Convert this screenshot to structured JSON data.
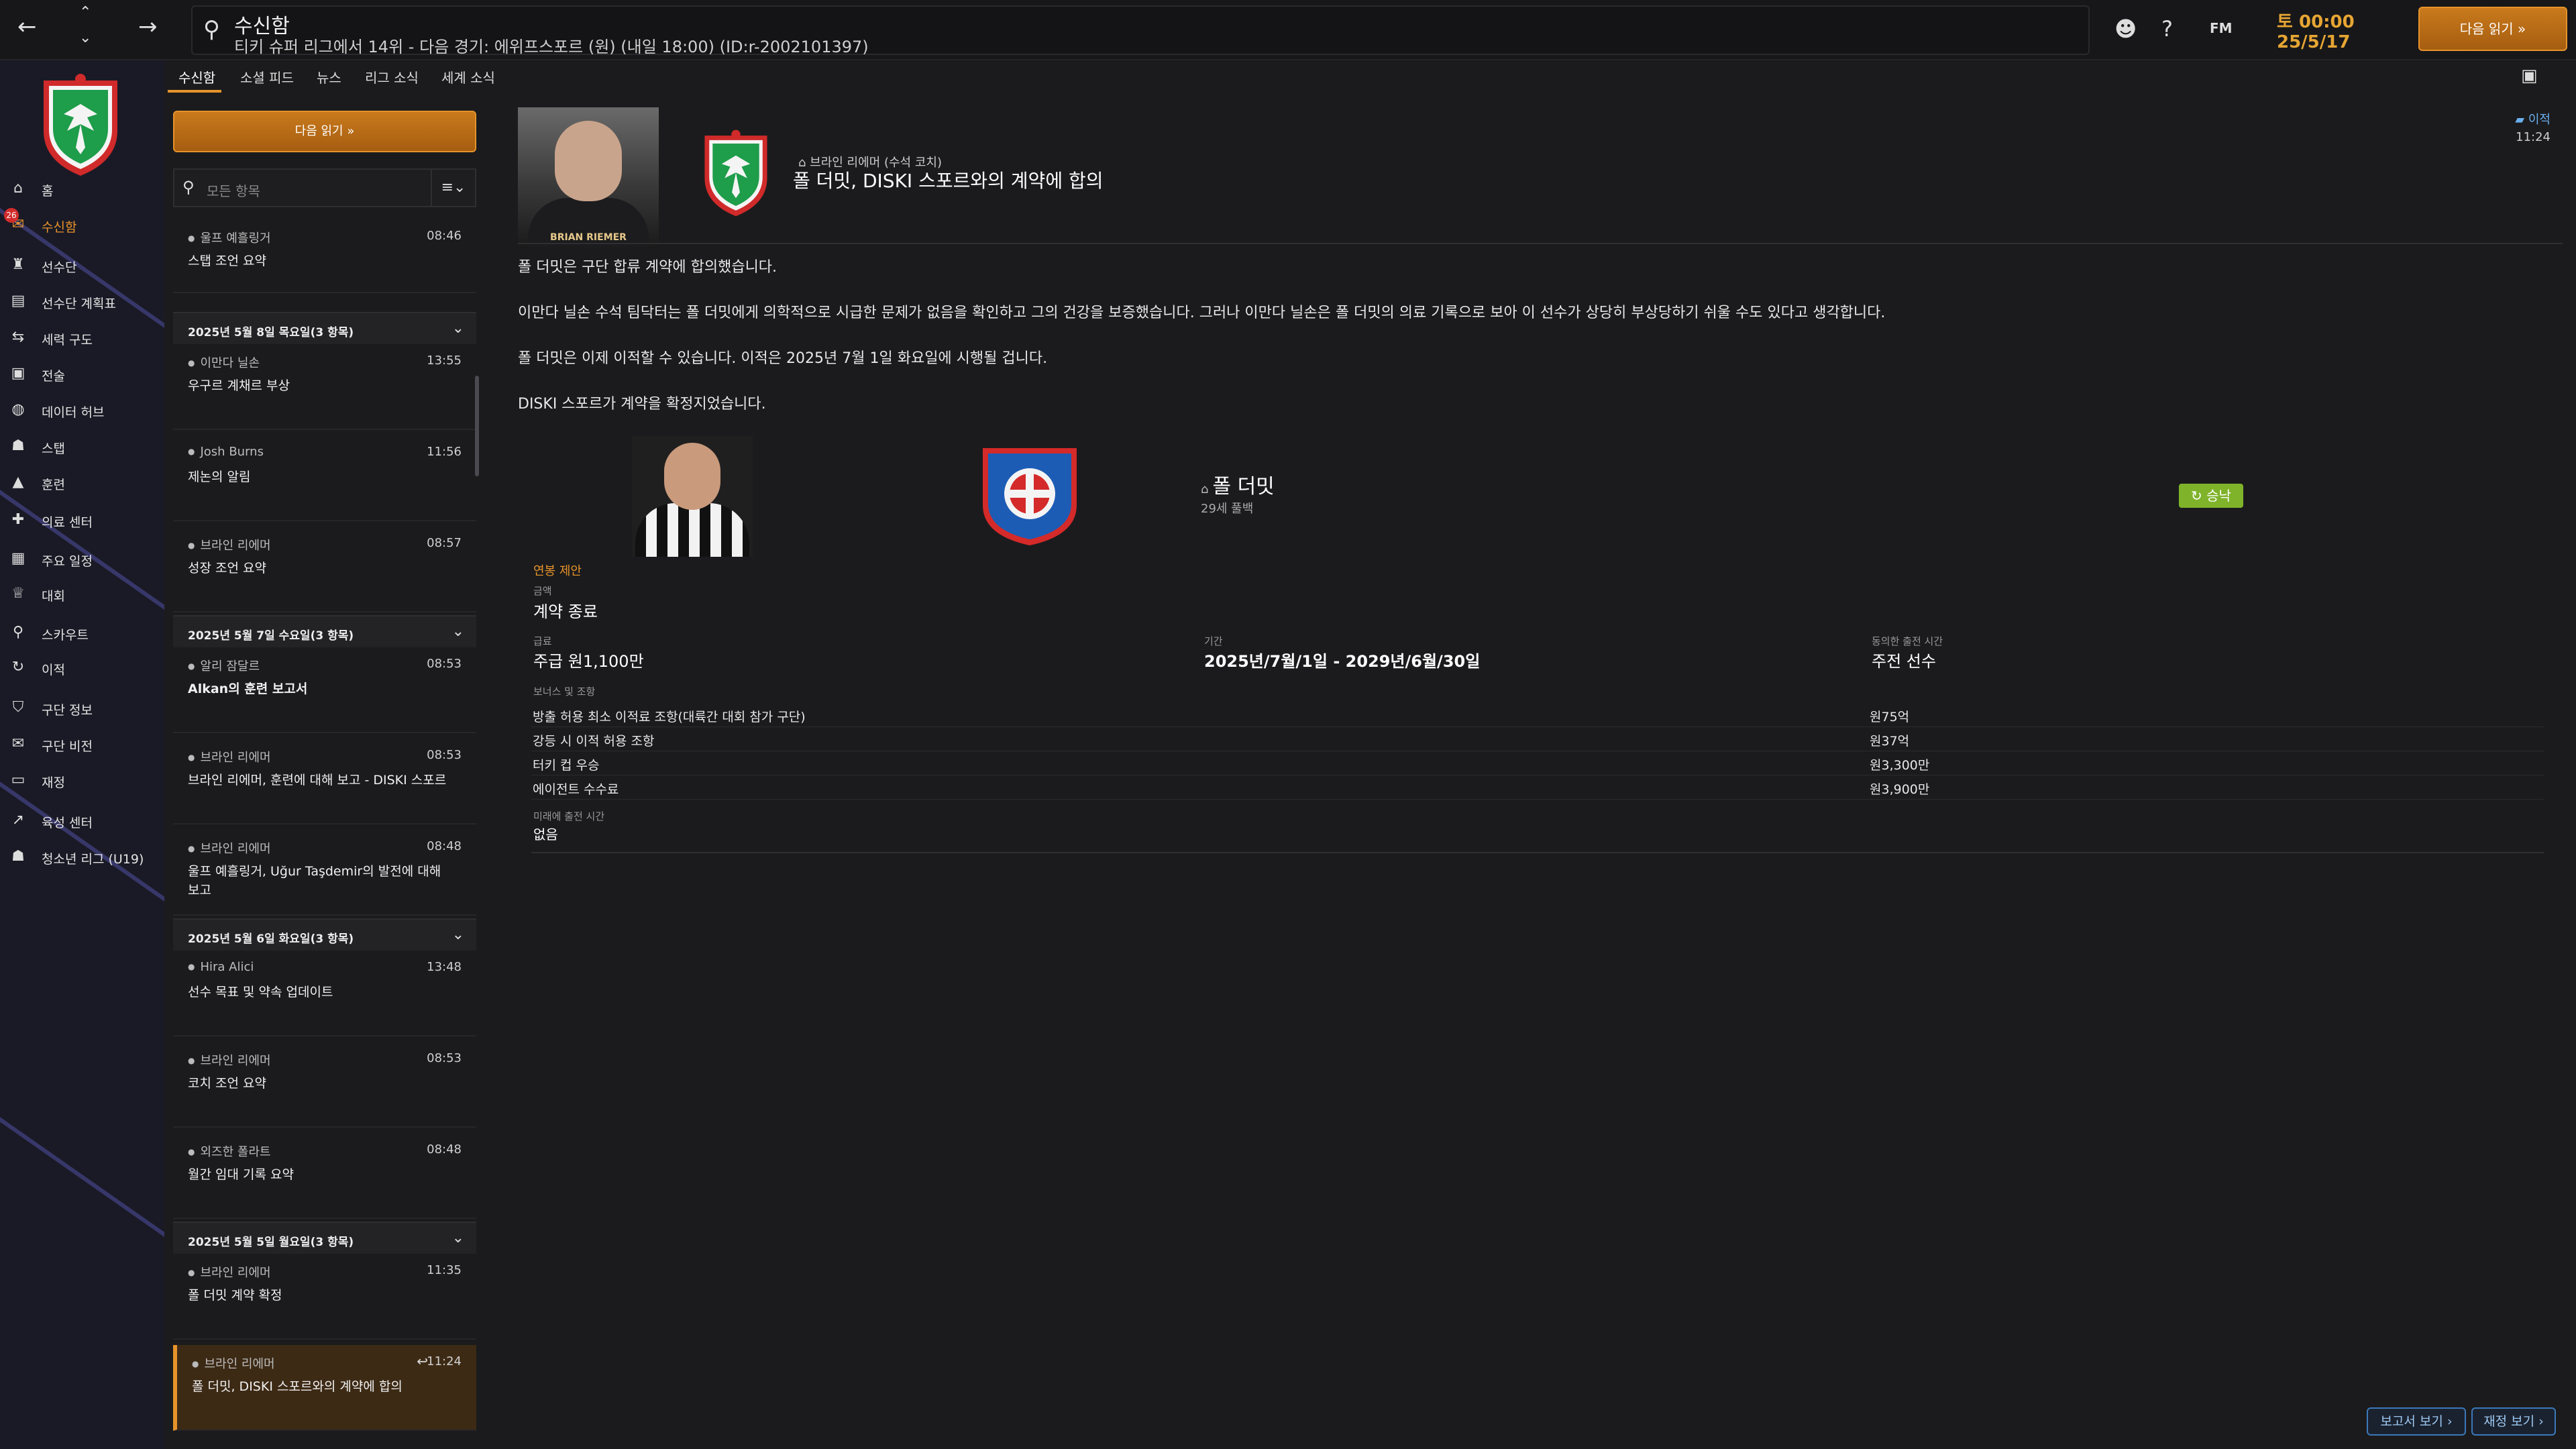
{
  "topbar": {
    "title": "수신함",
    "subtitle": "티키 슈퍼 리그에서 14위 - 다음 경기: 에위프스포르 (원) (내일 18:00) (ID:r-2002101397)",
    "game_time": "토 00:00",
    "game_date": "25/5/17",
    "continue_label": "다음 읽기",
    "fm_label": "FM"
  },
  "sidebar": {
    "inbox_badge": "26",
    "items": [
      {
        "label": "홈",
        "icon": "home-icon"
      },
      {
        "label": "수신함",
        "icon": "inbox-icon"
      },
      {
        "label": "선수단",
        "icon": "shirt-icon"
      },
      {
        "label": "선수단 계획표",
        "icon": "clipboard-icon"
      },
      {
        "label": "세력 구도",
        "icon": "dynamics-icon"
      },
      {
        "label": "전술",
        "icon": "tactics-icon"
      },
      {
        "label": "데이터 허브",
        "icon": "data-icon"
      },
      {
        "label": "스탭",
        "icon": "staff-icon"
      },
      {
        "label": "훈련",
        "icon": "training-icon"
      },
      {
        "label": "의료 센터",
        "icon": "medical-icon"
      },
      {
        "label": "주요 일정",
        "icon": "calendar-icon"
      },
      {
        "label": "대회",
        "icon": "trophy-icon"
      },
      {
        "label": "스카우트",
        "icon": "scout-icon"
      },
      {
        "label": "이적",
        "icon": "transfer-icon"
      },
      {
        "label": "구단 정보",
        "icon": "club-icon"
      },
      {
        "label": "구단 비전",
        "icon": "vision-icon"
      },
      {
        "label": "재정",
        "icon": "finance-icon"
      },
      {
        "label": "육성 센터",
        "icon": "development-icon"
      },
      {
        "label": "청소년 리그 (U19)",
        "icon": "youth-icon"
      }
    ]
  },
  "tabs": [
    "수신함",
    "소셜 피드",
    "뉴스",
    "리그 소식",
    "세계 소식"
  ],
  "list": {
    "continue_label": "다음 읽기",
    "search_placeholder": "모든 항목",
    "groups": [
      {
        "label": "2025년 5월 8일 목요일(3 항목)"
      },
      {
        "label": "2025년 5월 7일 수요일(3 항목)"
      },
      {
        "label": "2025년 5월 6일 화요일(3 항목)"
      },
      {
        "label": "2025년 5월 5일 월요일(3 항목)"
      }
    ],
    "messages": [
      {
        "sender": "울프 예흘링거",
        "time": "08:46",
        "subject": "스탭 조언 요약"
      },
      {
        "sender": "이만다 닐손",
        "time": "13:55",
        "subject": "우구르 계채르 부상"
      },
      {
        "sender": "Josh Burns",
        "time": "11:56",
        "subject": "제논의 알림"
      },
      {
        "sender": "브라인 리에머",
        "time": "08:57",
        "subject": "성장 조언 요약"
      },
      {
        "sender": "알리 잠달르",
        "time": "08:53",
        "subject": "Alkan의 훈련 보고서"
      },
      {
        "sender": "브라인 리에머",
        "time": "08:53",
        "subject": "브라인 리에머, 훈련에 대해 보고 - DISKI 스포르"
      },
      {
        "sender": "브라인 리에머",
        "time": "08:48",
        "subject": "울프 예흘링거, Uğur Taşdemir의 발전에 대해 보고"
      },
      {
        "sender": "Hira Alici",
        "time": "13:48",
        "subject": "선수 목표 및 약속 업데이트"
      },
      {
        "sender": "브라인 리에머",
        "time": "08:53",
        "subject": "코치 조언 요약"
      },
      {
        "sender": "외즈한 폴라트",
        "time": "08:48",
        "subject": "월간 임대 기록 요약"
      },
      {
        "sender": "브라인 리에머",
        "time": "11:35",
        "subject": "폴 더밋 계약 확정"
      },
      {
        "sender": "브라인 리에머",
        "time": "11:24",
        "subject": "폴 더밋, DISKI 스포르와의 계약에 합의"
      }
    ]
  },
  "message": {
    "from": "브라인 리에머 (수석 코치)",
    "title": "폴 더밋, DISKI 스포르와의 계약에 합의",
    "read_label": "이적",
    "time": "11:24",
    "coach_caption": "BRIAN RIEMER",
    "paragraphs": [
      "폴 더밋은 구단 합류 계약에 합의했습니다.",
      "이만다 닐손 수석 팀닥터는 폴 더밋에게 의학적으로 시급한 문제가 없음을 확인하고 그의 건강을 보증했습니다. 그러나 이만다 닐손은 폴 더밋의 의료 기록으로 보아 이 선수가 상당히 부상당하기 쉬울 수도 있다고 생각합니다.",
      "폴 더밋은 이제 이적할 수 있습니다. 이적은 2025년 7월 1일 화요일에 시행될 겁니다.",
      "DISKI 스포르가 계약을 확정지었습니다."
    ],
    "player": {
      "name": "폴 더밋",
      "age": "29세 풀백",
      "status": "승낙"
    },
    "offer": {
      "label": "연봉 제안",
      "fee_label": "금액",
      "fee_value": "계약 종료",
      "wage_label": "급료",
      "wage_value": "주급 원1,100만",
      "term_label": "기간",
      "term_value": "2025년/7월/1일 - 2029년/6월/30일",
      "role_label": "동의한 출전 시간",
      "role_value": "주전 선수",
      "bonus_header": "보너스 및 조항",
      "bonuses": [
        {
          "label": "방출 허용 최소 이적료 조항(대륙간 대회 참가 구단)",
          "value": "원75억"
        },
        {
          "label": "강등 시 이적 허용 조항",
          "value": "원37억"
        },
        {
          "label": "터키 컵 우승",
          "value": "원3,300만"
        },
        {
          "label": "에이전트 수수료",
          "value": "원3,900만"
        }
      ],
      "future_label": "미래에 출전 시간",
      "future_value": "없음"
    }
  },
  "bottom": {
    "report_label": "보고서 보기",
    "finance_label": "재정 보기"
  },
  "colors": {
    "accent": "#e6932b",
    "accepted": "#7fb32a",
    "link": "#9ec8f0"
  }
}
